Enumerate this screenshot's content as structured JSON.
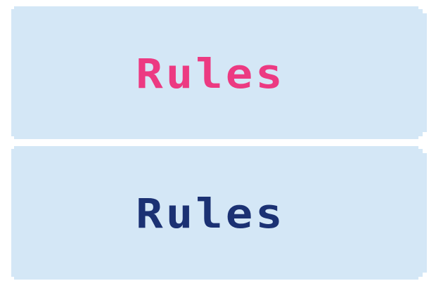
{
  "buttons": [
    {
      "label": "Rules",
      "state": "hover",
      "text_color": "#ec3a82"
    },
    {
      "label": "Rules",
      "state": "normal",
      "text_color": "#1b3173"
    }
  ],
  "colors": {
    "button_background": "#d4e7f6",
    "page_background": "#ffffff"
  }
}
